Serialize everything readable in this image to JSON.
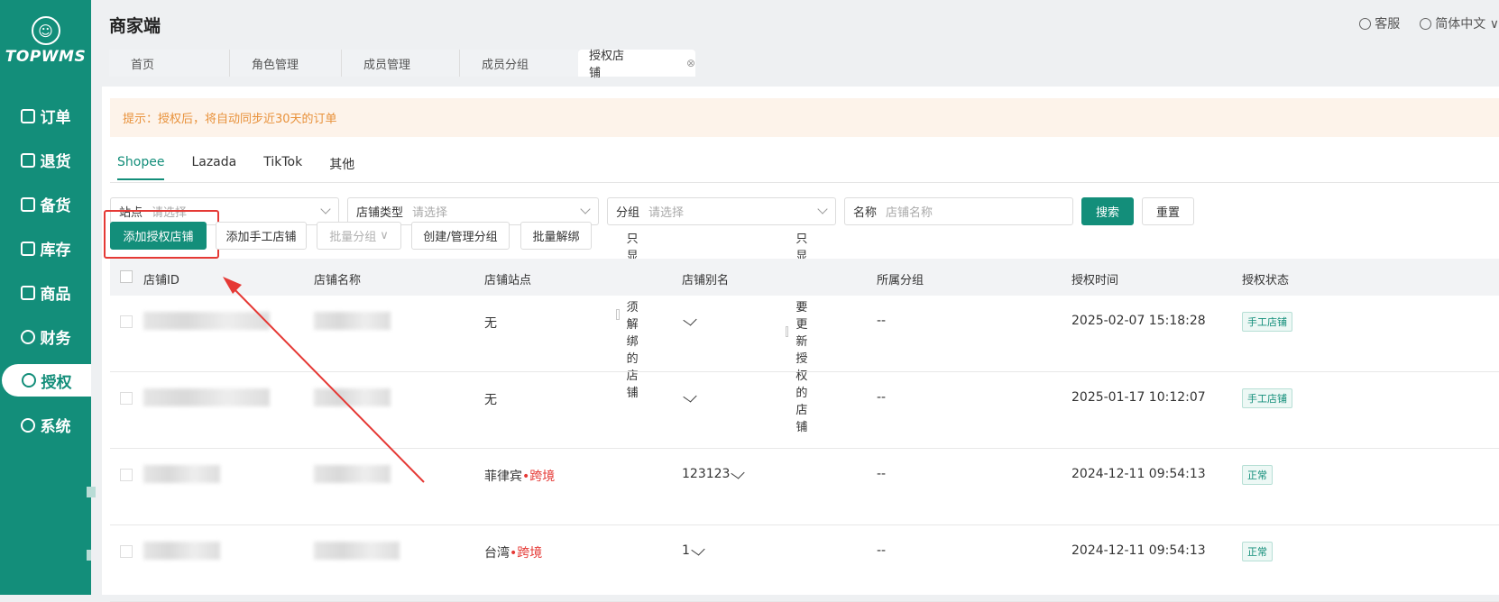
{
  "sidebar": {
    "logo_text": "TOPWMS",
    "items": [
      {
        "label": "订单",
        "icon": "order-icon"
      },
      {
        "label": "退货",
        "icon": "return-icon"
      },
      {
        "label": "备货",
        "icon": "stock-prep-icon"
      },
      {
        "label": "库存",
        "icon": "inventory-icon"
      },
      {
        "label": "商品",
        "icon": "product-icon"
      },
      {
        "label": "财务",
        "icon": "finance-icon"
      },
      {
        "label": "授权",
        "icon": "authorize-icon",
        "active": true
      },
      {
        "label": "系统",
        "icon": "settings-icon"
      }
    ]
  },
  "header": {
    "title": "商家端",
    "service": "客服",
    "language": "简体中文"
  },
  "page_tabs": [
    {
      "label": "首页"
    },
    {
      "label": "角色管理"
    },
    {
      "label": "成员管理"
    },
    {
      "label": "成员分组"
    },
    {
      "label": "授权店铺",
      "active": true
    }
  ],
  "tip": "提示：授权后，将自动同步近30天的订单",
  "platform_tabs": [
    {
      "label": "Shopee",
      "active": true
    },
    {
      "label": "Lazada"
    },
    {
      "label": "TikTok"
    },
    {
      "label": "其他"
    }
  ],
  "filters": {
    "site": {
      "label": "站点",
      "placeholder": "请选择"
    },
    "store_type": {
      "label": "店铺类型",
      "placeholder": "请选择"
    },
    "group": {
      "label": "分组",
      "placeholder": "请选择"
    },
    "name": {
      "label": "名称",
      "placeholder": "店铺名称"
    },
    "search": "搜索",
    "reset": "重置"
  },
  "toolbar": {
    "add_auth": "添加授权店铺",
    "add_manual": "添加手工店铺",
    "batch_group": "批量分组",
    "manage_group": "创建/管理分组",
    "batch_unbind": "批量解绑",
    "only_must_unbind": "只显示必须解绑的店铺",
    "only_need_reauth": "只显示需要更新授权的店铺"
  },
  "table": {
    "columns": [
      "店铺ID",
      "店铺名称",
      "店铺站点",
      "店铺别名",
      "所属分组",
      "授权时间",
      "授权状态"
    ],
    "rows": [
      {
        "site": "无",
        "site_tag": "",
        "alias": "",
        "group": "--",
        "time": "2025-02-07 15:18:28",
        "status": "手工店铺"
      },
      {
        "site": "无",
        "site_tag": "",
        "alias": "",
        "group": "--",
        "time": "2025-01-17 10:12:07",
        "status": "手工店铺"
      },
      {
        "site": "菲律宾",
        "site_tag": "跨境",
        "alias": "123123",
        "group": "--",
        "time": "2024-12-11 09:54:13",
        "status": "正常"
      },
      {
        "site": "台湾",
        "site_tag": "跨境",
        "alias": "1",
        "group": "--",
        "time": "2024-12-11 09:54:13",
        "status": "正常"
      }
    ]
  },
  "colors": {
    "brand": "#138e7a",
    "highlight": "#e53935",
    "tip_text": "#e8913a"
  }
}
